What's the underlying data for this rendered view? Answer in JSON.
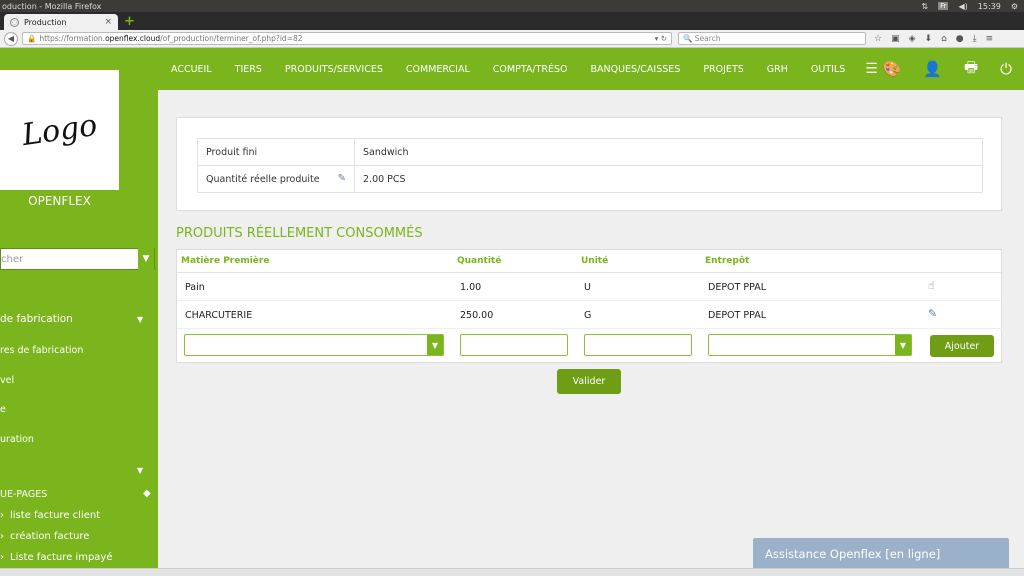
{
  "os": {
    "title": "oduction - Mozilla Firefox",
    "lang": "Fr",
    "time": "15:39"
  },
  "browser": {
    "tab_title": "Production",
    "url_prefix": "https://formation.",
    "url_domain": "openflex.cloud",
    "url_path": "/of_production/terminer_of.php?id=82",
    "search_placeholder": "Search"
  },
  "sidebar": {
    "logo_text": "Logo",
    "brand": "OPENFLEX",
    "search_placeholder": "cher",
    "items": [
      {
        "label": "de fabrication"
      },
      {
        "label": "res de fabrication"
      },
      {
        "label": "vel"
      },
      {
        "label": "e"
      },
      {
        "label": "uration"
      }
    ],
    "quick_pages_title": "UE-PAGES",
    "quick_pages": [
      {
        "label": "liste facture client"
      },
      {
        "label": "création facture"
      },
      {
        "label": "Liste facture impayé"
      }
    ]
  },
  "topnav": {
    "items": [
      "ACCUEIL",
      "TIERS",
      "PRODUITS/SERVICES",
      "COMMERCIAL",
      "COMPTA/TRÉSO",
      "BANQUES/CAISSES",
      "PROJETS",
      "GRH",
      "OUTILS"
    ]
  },
  "product": {
    "finished_label": "Produit fini",
    "finished_value": "Sandwich",
    "qty_label": "Quantité réelle produite",
    "qty_value": "2.00 PCS"
  },
  "consumed": {
    "title": "PRODUITS RÉELLEMENT CONSOMMÉS",
    "headers": {
      "material": "Matière Première",
      "quantity": "Quantité",
      "unit": "Unité",
      "warehouse": "Entrepôt"
    },
    "rows": [
      {
        "material": "Pain",
        "quantity": "1.00",
        "unit": "U",
        "warehouse": "DEPOT PPAL"
      },
      {
        "material": "CHARCUTERIE",
        "quantity": "250.00",
        "unit": "G",
        "warehouse": "DEPOT PPAL"
      }
    ],
    "add_label": "Ajouter",
    "validate_label": "Valider"
  },
  "assistance": {
    "label": "Assistance Openflex [en ligne]"
  }
}
